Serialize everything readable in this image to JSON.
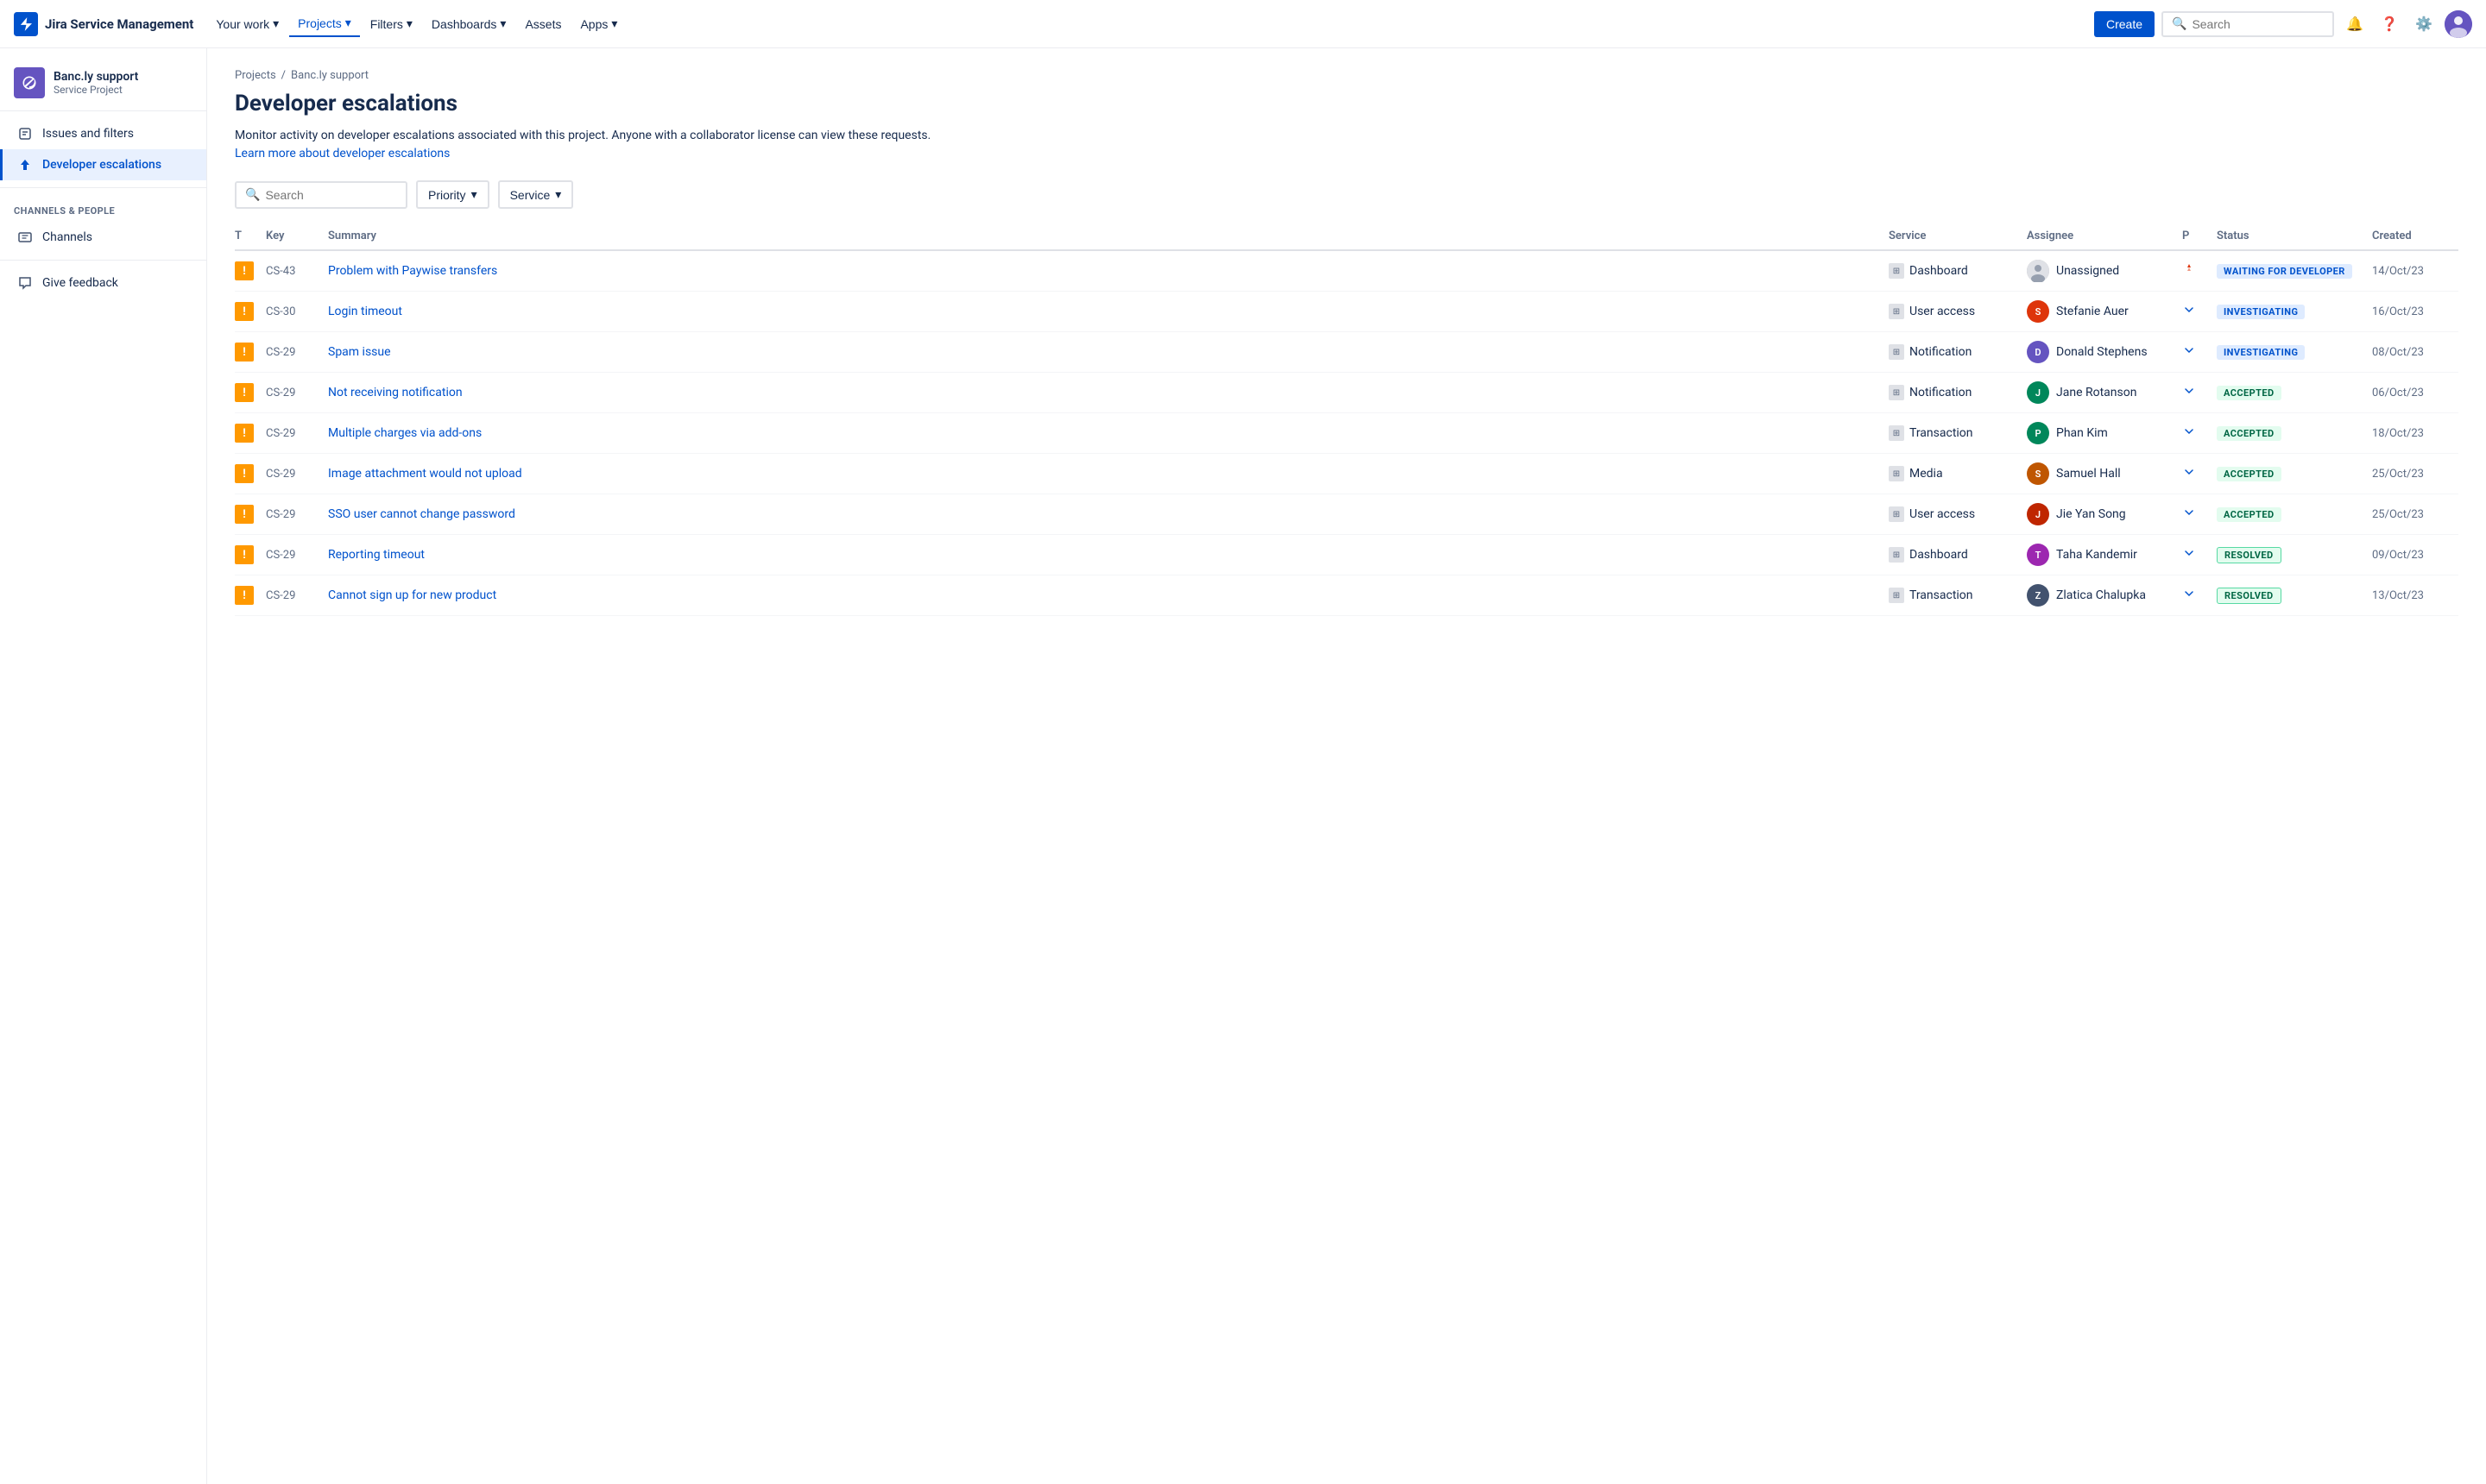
{
  "topnav": {
    "logo_text": "Jira Service Management",
    "nav_items": [
      {
        "label": "Your work",
        "has_arrow": true,
        "active": false
      },
      {
        "label": "Projects",
        "has_arrow": true,
        "active": true
      },
      {
        "label": "Filters",
        "has_arrow": true,
        "active": false
      },
      {
        "label": "Dashboards",
        "has_arrow": true,
        "active": false
      },
      {
        "label": "Assets",
        "has_arrow": false,
        "active": false
      },
      {
        "label": "Apps",
        "has_arrow": true,
        "active": false
      }
    ],
    "create_label": "Create",
    "search_placeholder": "Search"
  },
  "sidebar": {
    "project_name": "Banc.ly support",
    "project_type": "Service Project",
    "nav_items": [
      {
        "label": "Issues and filters",
        "icon": "issues-icon",
        "active": false
      },
      {
        "label": "Developer escalations",
        "icon": "escalations-icon",
        "active": true
      }
    ],
    "section_title": "CHANNELS & PEOPLE",
    "channels_items": [
      {
        "label": "Channels",
        "icon": "channels-icon"
      }
    ],
    "bottom_items": [
      {
        "label": "Give feedback",
        "icon": "feedback-icon"
      }
    ]
  },
  "breadcrumb": {
    "items": [
      "Projects",
      "Banc.ly support"
    ],
    "separator": "/"
  },
  "page": {
    "title": "Developer escalations",
    "description": "Monitor activity on developer escalations associated with this project. Anyone with a collaborator license can view these requests.",
    "learn_more_text": "Learn more about developer escalations",
    "learn_more_href": "#"
  },
  "filters": {
    "search_placeholder": "Search",
    "priority_label": "Priority",
    "service_label": "Service"
  },
  "table": {
    "columns": [
      "T",
      "Key",
      "Summary",
      "Service",
      "Assignee",
      "P",
      "Status",
      "Created"
    ],
    "rows": [
      {
        "type": "!",
        "key": "CS-43",
        "summary": "Problem with Paywise transfers",
        "service": "Dashboard",
        "assignee_name": "Unassigned",
        "assignee_color": "#aaa",
        "priority": "↑↑",
        "priority_color": "#de350b",
        "status": "WAITING FOR DEVELOPER",
        "status_class": "status-waiting",
        "created": "14/Oct/23"
      },
      {
        "type": "!",
        "key": "CS-30",
        "summary": "Login timeout",
        "service": "User access",
        "assignee_name": "Stefanie Auer",
        "assignee_color": "#de350b",
        "priority": "∨",
        "priority_color": "#0052cc",
        "status": "INVESTIGATING",
        "status_class": "status-investigating",
        "created": "16/Oct/23"
      },
      {
        "type": "!",
        "key": "CS-29",
        "summary": "Spam issue",
        "service": "Notification",
        "assignee_name": "Donald Stephens",
        "assignee_color": "#6554c0",
        "priority": "∨",
        "priority_color": "#0052cc",
        "status": "INVESTIGATING",
        "status_class": "status-investigating",
        "created": "08/Oct/23"
      },
      {
        "type": "!",
        "key": "CS-29",
        "summary": "Not receiving notification",
        "service": "Notification",
        "assignee_name": "Jane Rotanson",
        "assignee_color": "#00875a",
        "priority": "∨",
        "priority_color": "#0052cc",
        "status": "ACCEPTED",
        "status_class": "status-accepted",
        "created": "06/Oct/23"
      },
      {
        "type": "!",
        "key": "CS-29",
        "summary": "Multiple charges via add-ons",
        "service": "Transaction",
        "assignee_name": "Phan Kim",
        "assignee_color": "#00875a",
        "priority": "∨",
        "priority_color": "#0052cc",
        "status": "ACCEPTED",
        "status_class": "status-accepted",
        "created": "18/Oct/23"
      },
      {
        "type": "!",
        "key": "CS-29",
        "summary": "Image attachment would not upload",
        "service": "Media",
        "assignee_name": "Samuel Hall",
        "assignee_color": "#bf5600",
        "priority": "∨",
        "priority_color": "#0052cc",
        "status": "ACCEPTED",
        "status_class": "status-accepted",
        "created": "25/Oct/23"
      },
      {
        "type": "!",
        "key": "CS-29",
        "summary": "SSO user cannot change password",
        "service": "User access",
        "assignee_name": "Jie Yan Song",
        "assignee_color": "#bf2600",
        "priority": "∨",
        "priority_color": "#0052cc",
        "status": "ACCEPTED",
        "status_class": "status-accepted",
        "created": "25/Oct/23"
      },
      {
        "type": "!",
        "key": "CS-29",
        "summary": "Reporting timeout",
        "service": "Dashboard",
        "assignee_name": "Taha Kandemir",
        "assignee_color": "#9c27b0",
        "priority": "∨",
        "priority_color": "#0052cc",
        "status": "RESOLVED",
        "status_class": "status-resolved",
        "created": "09/Oct/23"
      },
      {
        "type": "!",
        "key": "CS-29",
        "summary": "Cannot sign up for new product",
        "service": "Transaction",
        "assignee_name": "Zlatica Chalupka",
        "assignee_color": "#42526e",
        "priority": "∨",
        "priority_color": "#0052cc",
        "status": "RESOLVED",
        "status_class": "status-resolved",
        "created": "13/Oct/23"
      }
    ]
  }
}
